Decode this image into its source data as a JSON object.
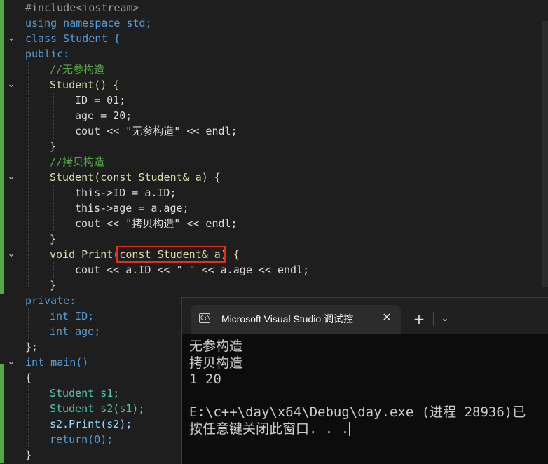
{
  "editor": {
    "lines": [
      "#include<iostream>",
      "using namespace std;",
      "class Student {",
      "public:",
      "//无参构造",
      "Student() {",
      "ID = 01;",
      "age = 20;",
      "cout << \"无参构造\" << endl;",
      "}",
      "//拷贝构造",
      "Student(const Student& a) {",
      "this->ID = a.ID;",
      "this->age = a.age;",
      "cout << \"拷贝构造\" << endl;",
      "}",
      "void Print(const Student& a) {",
      "cout << a.ID << \" \" << a.age << endl;",
      "}",
      "private:",
      "int ID;",
      "int age;",
      "};",
      "int main()",
      "{",
      "Student s1;",
      "Student s2(s1);",
      "s2.Print(s2);",
      "return(0);",
      "}"
    ],
    "fold_icon": "chevron-down-icon",
    "highlight_color": "#e0301e",
    "margin_color": "#57a64a"
  },
  "terminal": {
    "tab_title": "Microsoft Visual Studio 调试控",
    "tab_icon": "console-icon",
    "close_icon": "close-icon",
    "new_tab_icon": "plus-icon",
    "dropdown_icon": "chevron-down-icon",
    "output": [
      "无参构造",
      "拷贝构造",
      "1 20",
      "",
      "E:\\c++\\day\\x64\\Debug\\day.exe (进程 28936)已",
      "按任意键关闭此窗口. . ."
    ]
  }
}
